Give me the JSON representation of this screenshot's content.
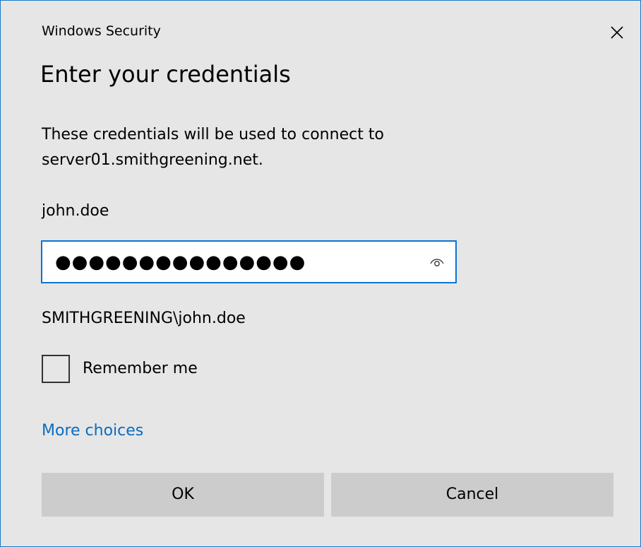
{
  "window": {
    "title": "Windows Security"
  },
  "dialog": {
    "heading": "Enter your credentials",
    "message_line1": "These credentials will be used to connect to",
    "message_line2": "server01.smithgreening.net.",
    "username": "john.doe",
    "password_masked": "●●●●●●●●●●●●●●●",
    "domain_user": "SMITHGREENING\\john.doe",
    "remember_label": "Remember me",
    "remember_checked": false,
    "more_choices_label": "More choices",
    "ok_label": "OK",
    "cancel_label": "Cancel"
  },
  "icons": {
    "close": "close-icon",
    "reveal": "eye-icon"
  },
  "colors": {
    "background": "#e6e6e6",
    "border_accent": "#1979ca",
    "input_focus_border": "#0a74d4",
    "link": "#0a6cc2",
    "button": "#cccccc"
  }
}
